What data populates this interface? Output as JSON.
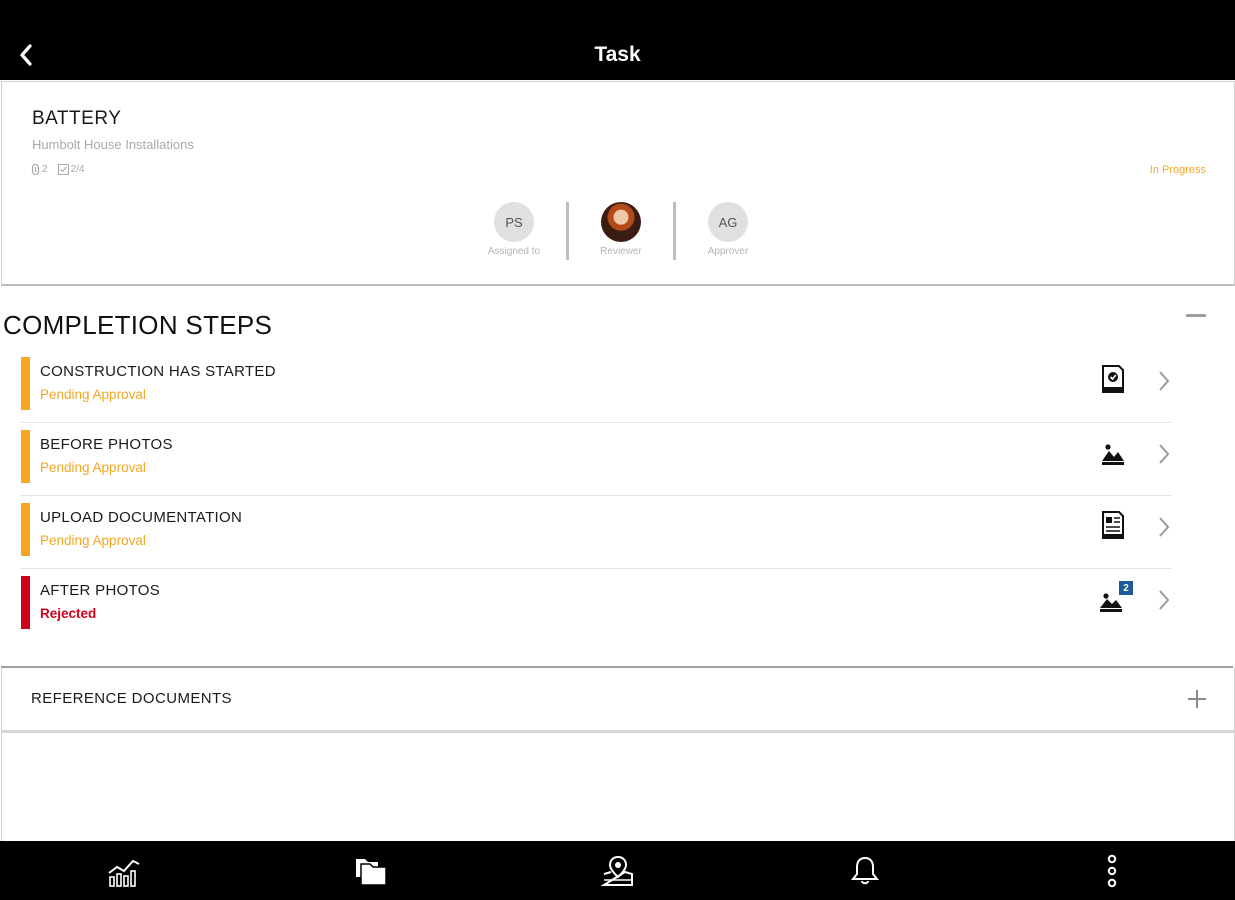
{
  "header": {
    "title": "Task"
  },
  "task": {
    "name": "BATTERY",
    "project": "Humbolt House Installations",
    "attachments_count": "2",
    "checklist": "2/4",
    "status": "In Progress"
  },
  "people": [
    {
      "initials": "PS",
      "role": "Assigned to"
    },
    {
      "initials": "",
      "role": "Reviewer"
    },
    {
      "initials": "AG",
      "role": "Approver"
    }
  ],
  "completion": {
    "title": "COMPLETION STEPS",
    "steps": [
      {
        "name": "CONSTRUCTION HAS STARTED",
        "status": "Pending Approval",
        "color": "#f5a623",
        "icon": "checklist-document-icon"
      },
      {
        "name": "BEFORE PHOTOS",
        "status": "Pending Approval",
        "color": "#f5a623",
        "icon": "photo-icon"
      },
      {
        "name": "UPLOAD DOCUMENTATION",
        "status": "Pending Approval",
        "color": "#f5a623",
        "icon": "document-icon"
      },
      {
        "name": "AFTER PHOTOS",
        "status": "Rejected",
        "color": "#d0021b",
        "icon": "photo-icon",
        "badge": "2"
      }
    ]
  },
  "reference": {
    "label": "REFERENCE DOCUMENTS"
  },
  "colors": {
    "pending": "#f5a623",
    "rejected": "#d0021b",
    "badge": "#1f5a96",
    "bar": "#000000"
  },
  "bottom_nav": [
    "analytics-icon",
    "folders-icon",
    "map-pin-icon",
    "bell-icon",
    "more-vertical-icon"
  ]
}
